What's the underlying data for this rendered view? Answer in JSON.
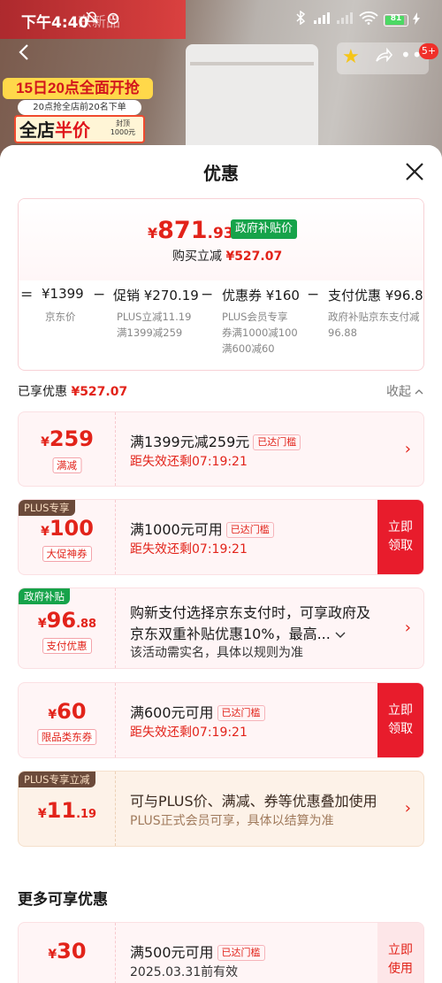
{
  "status_bar": {
    "time": "下午4:40",
    "battery": "81",
    "battery_level": 0.81,
    "faded_text": "东新品"
  },
  "background": {
    "promo_top": "15日20点全面开抢",
    "promo_mid": "20点抢全店前20名下单",
    "promo_big_a": "全店",
    "promo_big_b": "半价",
    "promo_small": "封顶1000元",
    "nav_badge": "5+"
  },
  "sheet": {
    "title": "优惠"
  },
  "summary": {
    "price_symbol": "¥",
    "price_int": "871",
    "price_dec": ".93",
    "gov_tag": "政府补贴价",
    "reduce_label": "购买立减",
    "reduce_value": "¥527.07",
    "breakdown": [
      {
        "op": "=",
        "value": "¥1399",
        "subs": [
          "京东价"
        ]
      },
      {
        "op": "−",
        "value": "促销 ¥270.19",
        "subs": [
          "PLUS立减11.19",
          "满1399减259"
        ]
      },
      {
        "op": "−",
        "value": "优惠券 ¥160",
        "subs": [
          "PLUS会员专享",
          "券满1000减100",
          "满600减60"
        ]
      },
      {
        "op": "−",
        "value": "支付优惠 ¥96.88",
        "subs": [
          "政府补贴京东支付减",
          "96.88"
        ]
      }
    ]
  },
  "enjoyed": {
    "label": "已享优惠",
    "value": "¥527.07",
    "collapse": "收起"
  },
  "coupons": [
    {
      "amount_symbol": "¥",
      "amount": "259",
      "amount_dec": "",
      "type": "满减",
      "title": "满1399元减259元",
      "badge": "已达门槛",
      "sub": "距失效还剩07:19:21",
      "flag": "",
      "button": ""
    },
    {
      "amount_symbol": "¥",
      "amount": "100",
      "amount_dec": "",
      "type": "大促神券",
      "title": "满1000元可用",
      "badge": "已达门槛",
      "sub": "距失效还剩07:19:21",
      "flag": "PLUS专享",
      "button": "立即领取"
    },
    {
      "amount_symbol": "¥",
      "amount": "96",
      "amount_dec": ".88",
      "type": "支付优惠",
      "title": "购新支付选择京东支付时，可享政府及",
      "title2": "京东双重补贴优惠10%，最高...",
      "sub": "该活动需实名，具体以规则为准",
      "flag": "政府补贴",
      "button": ""
    },
    {
      "amount_symbol": "¥",
      "amount": "60",
      "amount_dec": "",
      "type": "限品类东券",
      "title": "满600元可用",
      "badge": "已达门槛",
      "sub": "距失效还剩07:19:21",
      "flag": "",
      "button": "立即领取"
    },
    {
      "amount_symbol": "¥",
      "amount": "11",
      "amount_dec": ".19",
      "type": "",
      "title": "可与PLUS价、满减、券等优惠叠加使用",
      "sub": "PLUS正式会员可享，具体以结算为准",
      "flag": "PLUS专享立减",
      "button": ""
    }
  ],
  "more": {
    "title": "更多可享优惠",
    "coupon": {
      "amount_symbol": "¥",
      "amount": "30",
      "title": "满500元可用",
      "badge": "已达门槛",
      "sub": "2025.03.31前有效",
      "button": "立即使用"
    }
  },
  "colors": {
    "accent_red": "#e2231a",
    "button_red": "#e81c2c",
    "gov_green": "#16a34a",
    "plus_brown": "#6b4a3a"
  }
}
